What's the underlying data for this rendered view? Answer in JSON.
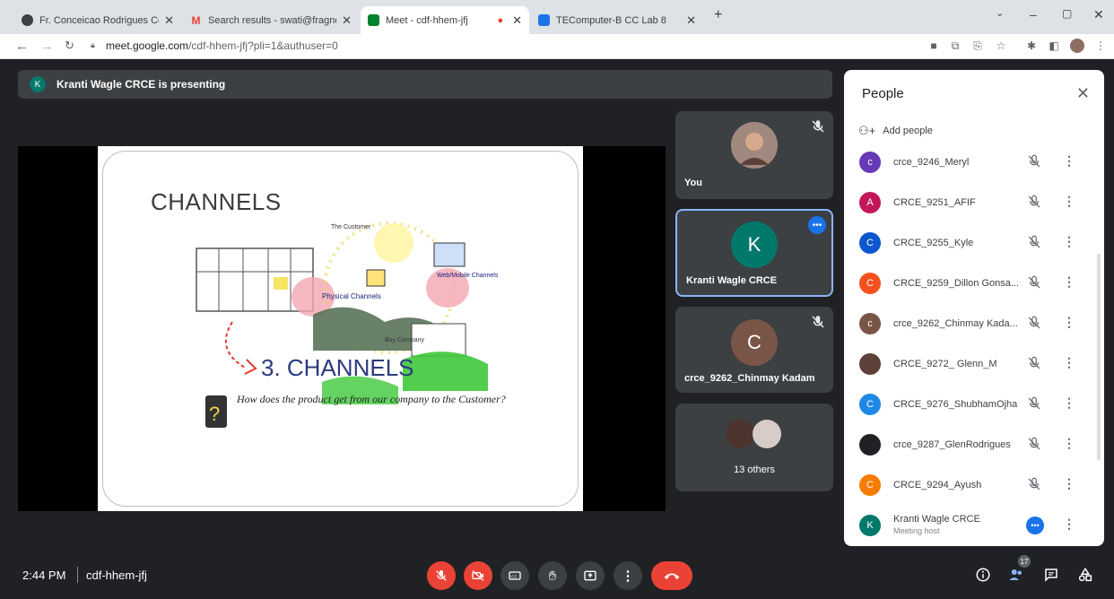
{
  "browser": {
    "tabs": [
      {
        "title": "Fr. Conceicao Rodrigues College",
        "color": "#3c4043",
        "letter": "●"
      },
      {
        "title": "Search results - swati@fragnel.e",
        "color": "#ea4335",
        "letter": "M"
      },
      {
        "title": "Meet - cdf-hhem-jfj",
        "color": "#00832d",
        "letter": "▶"
      },
      {
        "title": "TEComputer-B CC Lab 8",
        "color": "#1a73e8",
        "letter": "▪"
      }
    ],
    "url_host": "meet.google.com",
    "url_path": "/cdf-hhem-jfj?pli=1&authuser=0"
  },
  "banner": {
    "avatar_letter": "K",
    "text": "Kranti Wagle CRCE is presenting"
  },
  "slide": {
    "title": "CHANNELS",
    "headline": "3. CHANNELS",
    "question": "How does the product get from our company to the Customer?",
    "labels": {
      "customer": "The Customer",
      "physical": "Physical Channels",
      "web": "Web/Mobile Channels",
      "buy": "Buy Company"
    }
  },
  "tiles": [
    {
      "name": "You"
    },
    {
      "name": "Kranti Wagle CRCE",
      "letter": "K"
    },
    {
      "name": "crce_9262_Chinmay Kadam",
      "letter": "C"
    },
    {
      "name": "13 others"
    }
  ],
  "people": {
    "title": "People",
    "add_label": "Add people",
    "list": [
      {
        "name": "crce_9246_Meryl",
        "letter": "c",
        "color": "#673ab7"
      },
      {
        "name": "CRCE_9251_AFIF",
        "letter": "A",
        "color": "#c2185b"
      },
      {
        "name": "CRCE_9255_Kyle",
        "letter": "C",
        "color": "#0b57d0"
      },
      {
        "name": "CRCE_9259_Dillon Gonsa...",
        "letter": "C",
        "color": "#f4511e"
      },
      {
        "name": "crce_9262_Chinmay Kada...",
        "letter": "c",
        "color": "#795548"
      },
      {
        "name": "CRCE_9272_ Glenn_M",
        "letter": "",
        "color": "#5d4037"
      },
      {
        "name": "CRCE_9276_ShubhamOjha",
        "letter": "C",
        "color": "#1e88e5"
      },
      {
        "name": "crce_9287_GlenRodrigues",
        "letter": "",
        "color": "#202124"
      },
      {
        "name": "CRCE_9294_Ayush",
        "letter": "C",
        "color": "#f57c00"
      },
      {
        "name": "Kranti Wagle CRCE",
        "letter": "K",
        "color": "#00796b",
        "sub": "Meeting host"
      }
    ]
  },
  "footer": {
    "time": "2:44 PM",
    "code": "cdf-hhem-jfj",
    "people_count": "17"
  },
  "colors": {
    "danger": "#ea4335",
    "meet_bg": "#202124",
    "tile_bg": "#3c4043",
    "active_border": "#8ab4f8"
  }
}
